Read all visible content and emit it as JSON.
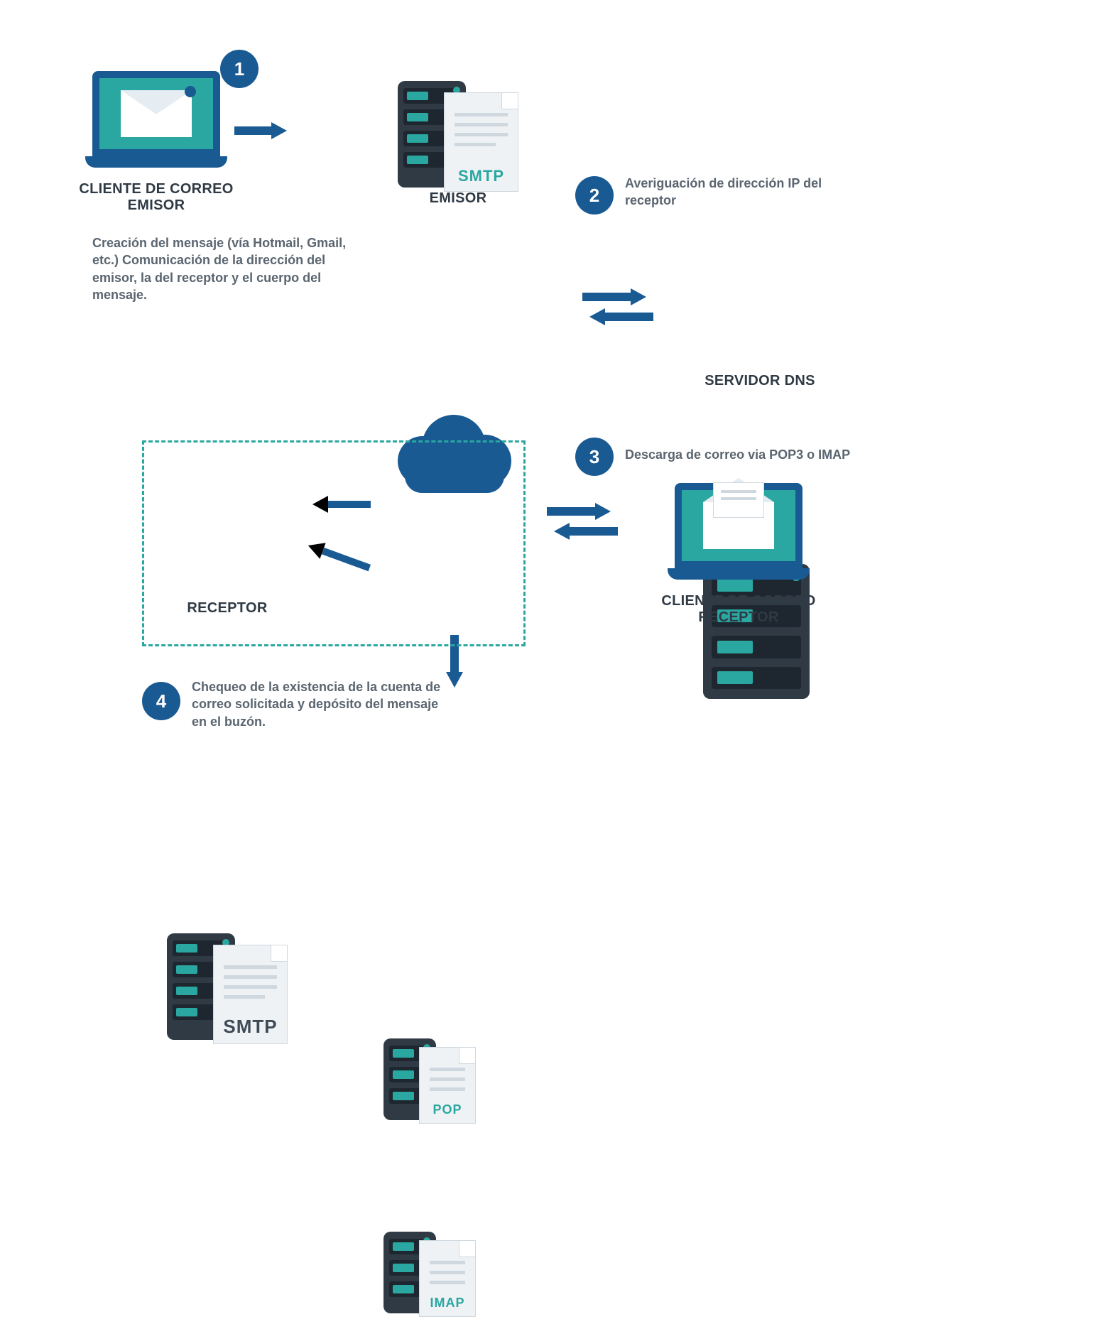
{
  "labels": {
    "client_sender_title": "CLIENTE DE CORREO EMISOR",
    "client_sender_body": "Creación del mensaje (vía Hotmail, Gmail, etc.) Comunicación de la dirección del emisor, la del receptor y el cuerpo del mensaje.",
    "emisor_title": "EMISOR",
    "dns_title": "SERVIDOR DNS",
    "receptor_client_title": "CLIENTE DE CORREO RECEPTOR",
    "receptor_server_title": "RECEPTOR"
  },
  "protocols": {
    "smtp_top": "SMTP",
    "smtp_bottom": "SMTP",
    "pop": "POP",
    "imap": "IMAP"
  },
  "steps": {
    "s1": {
      "num": "1",
      "text": ""
    },
    "s2": {
      "num": "2",
      "text": "Averiguación de dirección IP del receptor"
    },
    "s3": {
      "num": "3",
      "text": "Descarga de correo via POP3 o IMAP"
    },
    "s4": {
      "num": "4",
      "text": "Chequeo de la existencia de la cuenta de correo solicitada y depósito del mensaje en el buzón."
    }
  },
  "colors": {
    "primary": "#195a93",
    "accent": "#2aa7a0",
    "dark": "#2f3a44"
  }
}
